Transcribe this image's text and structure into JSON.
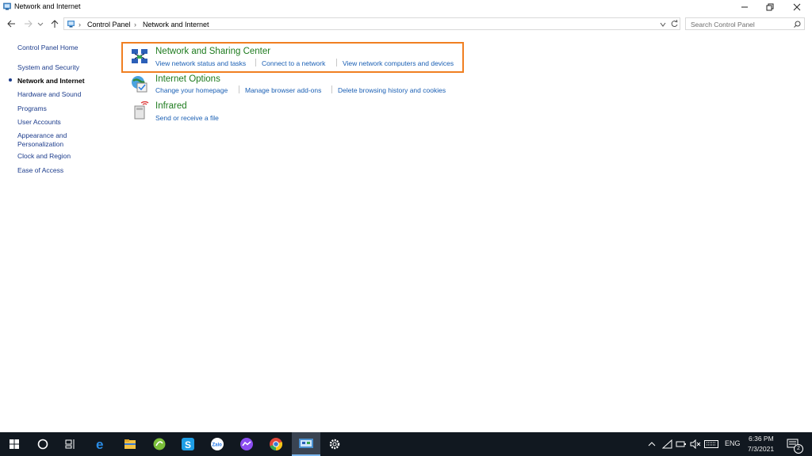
{
  "window": {
    "title": "Network and Internet",
    "minimize_icon": "minimize-icon",
    "restore_icon": "restore-icon",
    "close_icon": "close-icon"
  },
  "address_bar": {
    "crumbs": [
      "Control Panel",
      "Network and Internet"
    ],
    "search_placeholder": "Search Control Panel"
  },
  "sidebar": {
    "items": [
      {
        "label": "Control Panel Home"
      },
      {
        "label": "System and Security"
      },
      {
        "label": "Network and Internet",
        "active": true
      },
      {
        "label": "Hardware and Sound"
      },
      {
        "label": "Programs"
      },
      {
        "label": "User Accounts"
      },
      {
        "label": "Appearance and"
      },
      {
        "label": "Personalization"
      },
      {
        "label": "Clock and Region"
      },
      {
        "label": "Ease of Access"
      }
    ]
  },
  "categories": [
    {
      "title": "Network and Sharing Center",
      "icon": "network-sharing-icon",
      "links": [
        "View network status and tasks",
        "Connect to a network",
        "View network computers and devices"
      ]
    },
    {
      "title": "Internet Options",
      "icon": "internet-options-icon",
      "links": [
        "Change your homepage",
        "Manage browser add-ons",
        "Delete browsing history and cookies"
      ]
    },
    {
      "title": "Infrared",
      "icon": "infrared-icon",
      "links": [
        "Send or receive a file"
      ]
    }
  ],
  "colors": {
    "highlight": "#f07f21",
    "category_title": "#1e7b1e",
    "link": "#1a5fb4",
    "taskbar": "#111820"
  },
  "taskbar": {
    "apps": [
      "start-icon",
      "search-icon",
      "task-view-icon",
      "edge-icon",
      "file-explorer-icon",
      "green-app-icon",
      "skype-icon",
      "zalo-icon",
      "messenger-icon",
      "chrome-icon",
      "control-panel-icon",
      "settings-icon"
    ],
    "zalo_label": "Zalo",
    "language": "ENG",
    "time": "6:36 PM",
    "date": "7/3/2021",
    "notification_count": "2"
  }
}
